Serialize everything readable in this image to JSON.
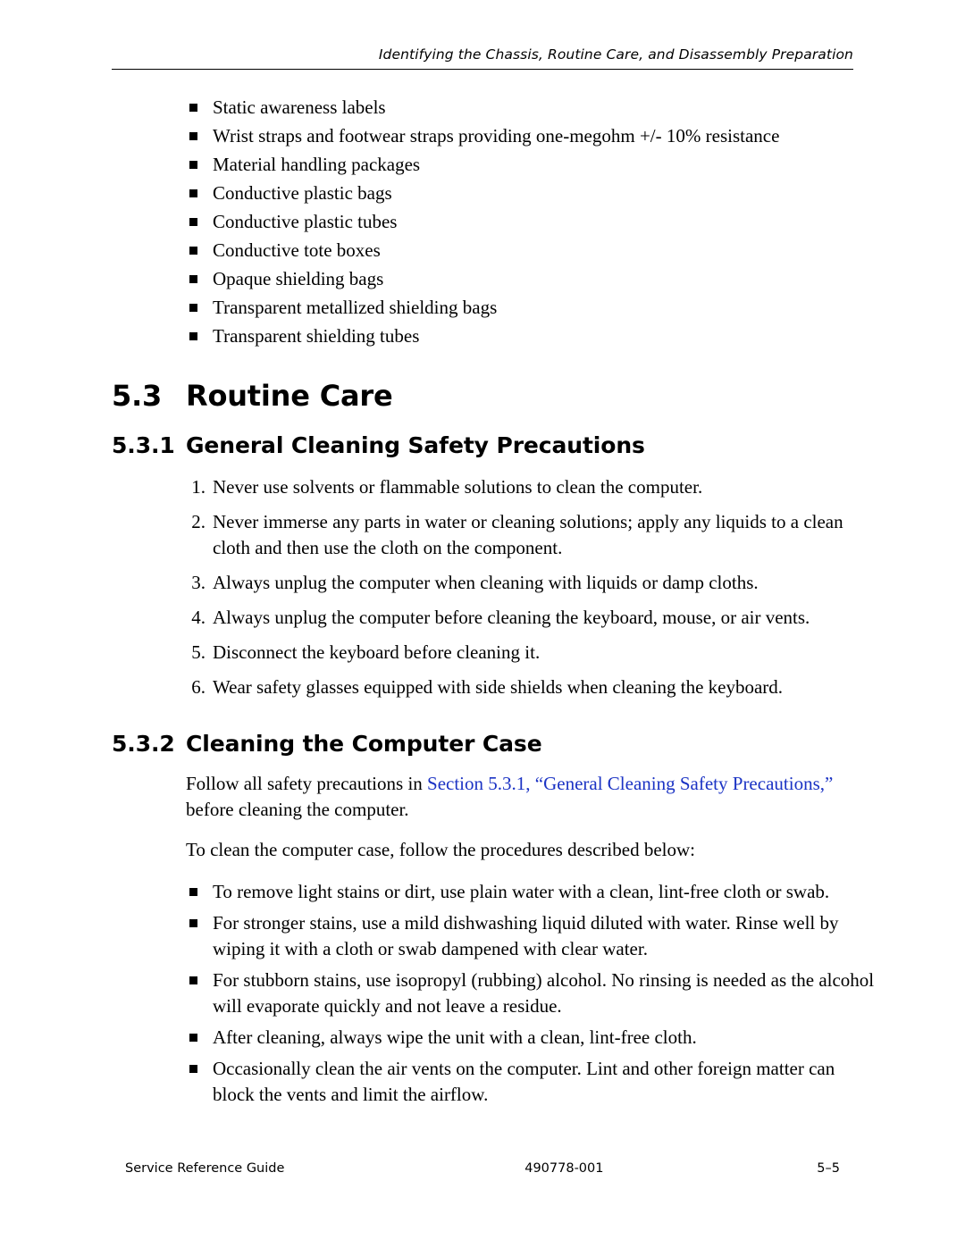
{
  "header": {
    "running_head": "Identifying the Chassis, Routine Care, and Disassembly Preparation"
  },
  "top_list": [
    "Static awareness labels",
    "Wrist straps and footwear straps providing one-megohm +/- 10% resistance",
    "Material handling packages",
    "Conductive plastic bags",
    "Conductive plastic tubes",
    "Conductive tote boxes",
    "Opaque shielding bags",
    "Transparent metallized shielding bags",
    "Transparent shielding tubes"
  ],
  "section": {
    "number": "5.3",
    "title": "Routine Care"
  },
  "subsection1": {
    "number": "5.3.1",
    "title": "General Cleaning Safety Precautions",
    "steps": [
      {
        "n": "1.",
        "text": "Never use solvents or flammable solutions to clean the computer."
      },
      {
        "n": "2.",
        "text": "Never immerse any parts in water or cleaning solutions; apply any liquids to a clean cloth and then use the cloth on the component."
      },
      {
        "n": "3.",
        "text": "Always unplug the computer when cleaning with liquids or damp cloths."
      },
      {
        "n": "4.",
        "text": "Always unplug the computer before cleaning the keyboard, mouse, or air vents."
      },
      {
        "n": "5.",
        "text": "Disconnect the keyboard before cleaning it."
      },
      {
        "n": "6.",
        "text": "Wear safety glasses equipped with side shields when cleaning the keyboard."
      }
    ]
  },
  "subsection2": {
    "number": "5.3.2",
    "title": "Cleaning the Computer Case",
    "intro_before_link": "Follow all safety precautions in ",
    "intro_link": "Section 5.3.1, “General Cleaning Safety Precautions,”",
    "intro_after_link": " before cleaning the computer.",
    "link_color": "#1b33c4",
    "intro2": "To clean the computer case, follow the procedures described below:",
    "bullets": [
      "To remove light stains or dirt, use plain water with a clean, lint-free cloth or swab.",
      "For stronger stains, use a mild dishwashing liquid diluted with water. Rinse well by wiping it with a cloth or swab dampened with clear water.",
      "For stubborn stains, use isopropyl (rubbing) alcohol. No rinsing is needed as the alcohol will evaporate quickly and not leave a residue.",
      "After cleaning, always wipe the unit with a clean, lint-free cloth.",
      "Occasionally clean the air vents on the computer. Lint and other foreign matter can block the vents and limit the airflow."
    ]
  },
  "footer": {
    "left": "Service Reference Guide",
    "center": "490778-001",
    "right": "5–5"
  }
}
